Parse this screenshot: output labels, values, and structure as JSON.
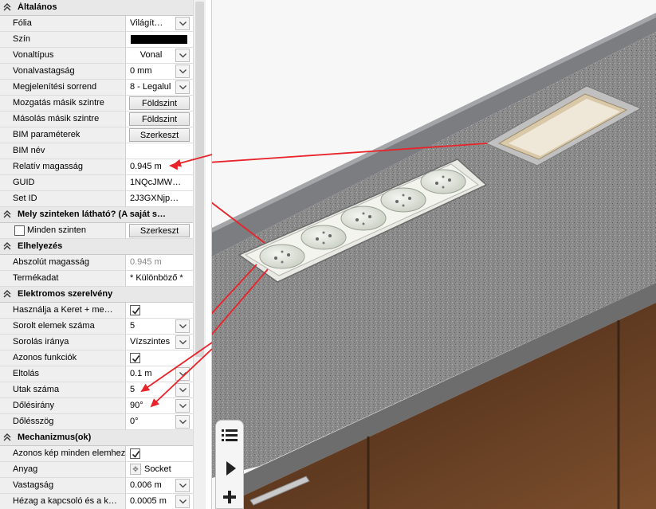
{
  "sections": [
    {
      "title": "Általános",
      "rows": [
        {
          "label": "Fólia",
          "type": "combo",
          "value": "Világít…"
        },
        {
          "label": "Szín",
          "type": "color",
          "value": "#000000"
        },
        {
          "label": "Vonaltípus",
          "type": "combo-center",
          "value": "Vonal"
        },
        {
          "label": "Vonalvastagság",
          "type": "combo",
          "value": "0 mm"
        },
        {
          "label": "Megjelenítési sorrend",
          "type": "combo",
          "value": "8 - Legalul"
        },
        {
          "label": "Mozgatás másik szintre",
          "type": "button",
          "value": "Földszint"
        },
        {
          "label": "Másolás másik szintre",
          "type": "button",
          "value": "Földszint"
        },
        {
          "label": "BIM paraméterek",
          "type": "button",
          "value": "Szerkeszt"
        },
        {
          "label": "BIM név",
          "type": "text",
          "value": ""
        },
        {
          "label": "Relatív magasság",
          "type": "text",
          "value": "0.945 m"
        },
        {
          "label": "GUID",
          "type": "text",
          "value": "1NQcJMW…"
        },
        {
          "label": "Set ID",
          "type": "text",
          "value": "2J3GXNjp…"
        }
      ]
    },
    {
      "title": "Mely szinteken látható? (A saját s…",
      "rows": [
        {
          "label": "Minden szinten",
          "type": "check-left-button",
          "value": "Szerkeszt"
        }
      ]
    },
    {
      "title": "Elhelyezés",
      "rows": [
        {
          "label": "Abszolút magasság",
          "type": "text-grey",
          "value": "0.945 m"
        },
        {
          "label": "Termékadat",
          "type": "text",
          "value": "* Különböző *"
        }
      ]
    },
    {
      "title": "Elektromos szerelvény",
      "rows": [
        {
          "label": "Használja a Keret + me…",
          "type": "check",
          "value": "checked"
        },
        {
          "label": "Sorolt elemek száma",
          "type": "combo",
          "value": "5"
        },
        {
          "label": "Sorolás iránya",
          "type": "combo",
          "value": "Vízszintes"
        },
        {
          "label": "Azonos funkciók",
          "type": "check",
          "value": "checked"
        },
        {
          "label": "Eltolás",
          "type": "combo",
          "value": "0.1 m"
        },
        {
          "label": "Utak száma",
          "type": "combo",
          "value": "5"
        },
        {
          "label": "Dőlésirány",
          "type": "combo",
          "value": "90°"
        },
        {
          "label": "Dőlésszög",
          "type": "combo",
          "value": "0°"
        }
      ]
    },
    {
      "title": "Mechanizmus(ok)",
      "rows": [
        {
          "label": "Azonos kép minden elemhez",
          "type": "check",
          "value": "checked"
        },
        {
          "label": "Anyag",
          "type": "material",
          "value": "Socket"
        },
        {
          "label": "Vastagság",
          "type": "combo",
          "value": "0.006 m"
        },
        {
          "label": "Hézag a kapcsoló és a k…",
          "type": "combo",
          "value": "0.0005 m"
        }
      ]
    }
  ],
  "icons": {
    "section_toggle": "double-chevron-up-icon",
    "dropdown": "chevron-down-icon",
    "checkbox": "checkmark-icon",
    "material": "material-swatch-icon",
    "toolbox": [
      "list-icon",
      "play-icon",
      "plus-icon"
    ]
  },
  "colors": {
    "annotation_arrow": "#e8232a",
    "countertop": "#8c8c8c",
    "cabinet_wood": "#6b4226",
    "section_bg": "#e8e8e8"
  }
}
